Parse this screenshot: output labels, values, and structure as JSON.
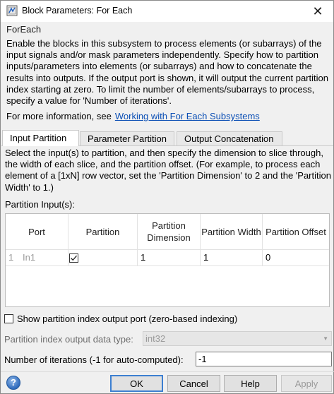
{
  "window": {
    "title": "Block Parameters: For Each"
  },
  "block_name": "ForEach",
  "description": "Enable the blocks in this subsystem to process elements (or subarrays) of the input signals and/or mask parameters independently. Specify how to partition inputs/parameters into elements (or subarrays) and how to concatenate the results into outputs. If the output port is shown, it will output the current partition index starting at zero.  To limit the number of elements/subarrays to process, specify a value for 'Number of iterations'.",
  "more_info": {
    "prefix": "For more information, see",
    "link": "Working with For Each Subsystems"
  },
  "tabs": [
    {
      "label": "Input Partition",
      "active": true
    },
    {
      "label": "Parameter Partition",
      "active": false
    },
    {
      "label": "Output Concatenation",
      "active": false
    }
  ],
  "input_partition": {
    "instructions": "Select the input(s) to partition, and then specify the dimension to slice through, the width of each slice, and the partition offset. (For example, to process each element of a [1xN] row vector, set the 'Partition Dimension' to 2 and the 'Partition Width' to 1.)",
    "table_label": "Partition Input(s):",
    "columns": [
      "Port",
      "Partition",
      "Partition Dimension",
      "Partition Width",
      "Partition Offset"
    ],
    "rows": [
      {
        "index": "1",
        "port": "In1",
        "partition": true,
        "dimension": "1",
        "width": "1",
        "offset": "0"
      }
    ]
  },
  "show_port": {
    "label": "Show partition index output port (zero-based indexing)",
    "checked": false
  },
  "output_data_type": {
    "label": "Partition index output data type:",
    "value": "int32"
  },
  "iterations": {
    "label": "Number of iterations (-1 for auto-computed):",
    "value": "-1"
  },
  "buttons": {
    "ok": "OK",
    "cancel": "Cancel",
    "help": "Help",
    "apply": "Apply"
  },
  "icons": {
    "help": "help-icon",
    "close": "close-icon",
    "app": "simulink-icon"
  }
}
